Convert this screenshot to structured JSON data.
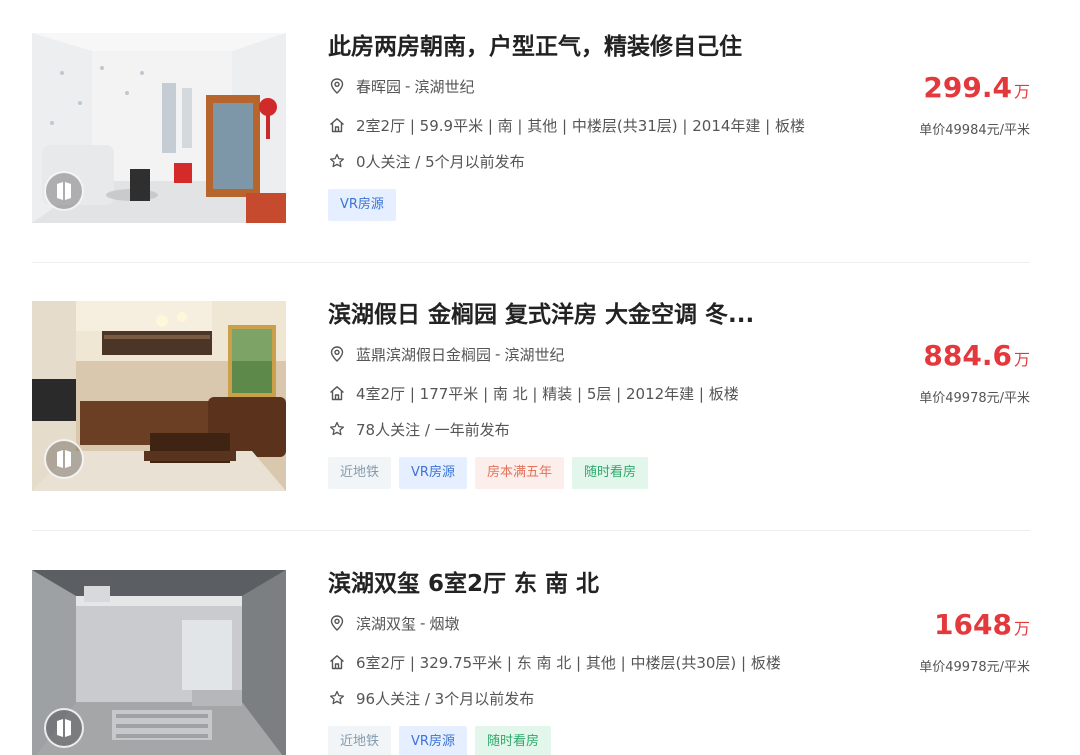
{
  "listings": [
    {
      "title": "此房两房朝南，户型正气，精装修自己住",
      "community": "春晖园",
      "district": "滨湖世纪",
      "info": "2室2厅 | 59.9平米 | 南 | 其他 | 中楼层(共31层) | 2014年建 | 板楼",
      "follow": "0人关注 / 5个月以前发布",
      "price": "299.4",
      "price_unit": "万",
      "unit_price": "单价49984元/平米",
      "tags": [
        "VR房源"
      ]
    },
    {
      "title": "滨湖假日 金榈园 复式洋房 大金空调 冬...",
      "community": "蓝鼎滨湖假日金榈园",
      "district": "滨湖世纪",
      "info": "4室2厅 | 177平米 | 南 北 | 精装 | 5层 | 2012年建 | 板楼",
      "follow": "78人关注 / 一年前发布",
      "price": "884.6",
      "price_unit": "万",
      "unit_price": "单价49978元/平米",
      "tags": [
        "近地铁",
        "VR房源",
        "房本满五年",
        "随时看房"
      ]
    },
    {
      "title": "滨湖双玺 6室2厅 东 南 北",
      "community": "滨湖双玺",
      "district": "烟墩",
      "info": "6室2厅 | 329.75平米 | 东 南 北 | 其他 | 中楼层(共30层) | 板楼",
      "follow": "96人关注 / 3个月以前发布",
      "price": "1648",
      "price_unit": "万",
      "unit_price": "单价49978元/平米",
      "tags": [
        "近地铁",
        "VR房源",
        "随时看房"
      ]
    }
  ],
  "separator": "-",
  "icons": {
    "location": "location-pin-icon",
    "house": "house-icon",
    "follow": "star-icon",
    "vr": "vr-badge-icon"
  },
  "colors": {
    "price": "#e4393c",
    "tag_vr": "#3b73d6",
    "tag_subway": "#849aae",
    "tag_five_years": "#e4735b",
    "tag_see_anytime": "#2fa86a"
  }
}
